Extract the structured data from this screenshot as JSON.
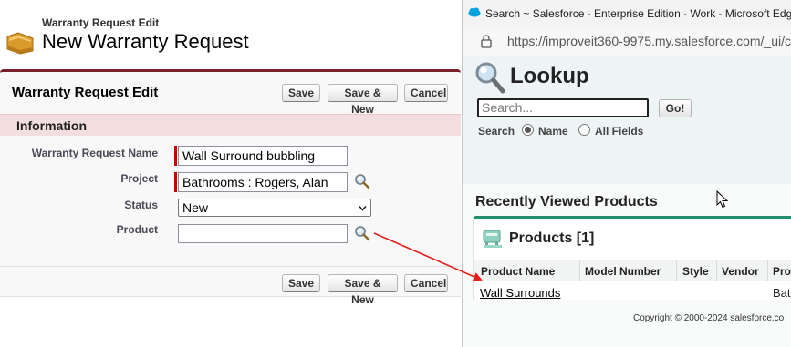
{
  "edit_page": {
    "subtitle": "Warranty Request Edit",
    "title": "New Warranty Request",
    "block_title": "Warranty Request Edit",
    "buttons": {
      "save": "Save",
      "save_new": "Save & New",
      "cancel": "Cancel"
    },
    "section_title": "Information",
    "fields": {
      "name_label": "Warranty Request Name",
      "name_value": "Wall Surround bubbling",
      "project_label": "Project",
      "project_value": "Bathrooms : Rogers, Alan",
      "status_label": "Status",
      "status_value": "New",
      "product_label": "Product",
      "product_value": ""
    }
  },
  "popup": {
    "window_title": "Search ~ Salesforce - Enterprise Edition - Work - Microsoft Edge",
    "url": "https://improveit360-9975.my.salesforce.com/_ui/c",
    "lookup_title": "Lookup",
    "search_placeholder": "Search...",
    "go_label": "Go!",
    "scope_label": "Search",
    "scope_name": "Name",
    "scope_all": "All Fields",
    "recent_title": "Recently Viewed Products",
    "list_title": "Products [1]",
    "columns": [
      "Product Name",
      "Model Number",
      "Style",
      "Vendor",
      "Pro"
    ],
    "rows": [
      {
        "product_name": "Wall Surrounds",
        "model_number": "",
        "style": "",
        "vendor": "",
        "pro": "Bath"
      }
    ],
    "copyright": "Copyright © 2000-2024 salesforce.co"
  },
  "colors": {
    "block_accent": "#7a1f2e",
    "section_bg": "#f2dedf",
    "required": "#cc0000",
    "list_accent": "#1f8f67",
    "annotation_arrow": "#e0201a"
  },
  "icons": [
    "folder-icon",
    "lookup-icon",
    "salesforce-cloud-icon",
    "lock-icon",
    "magnifier-icon",
    "products-icon",
    "cursor-icon"
  ]
}
